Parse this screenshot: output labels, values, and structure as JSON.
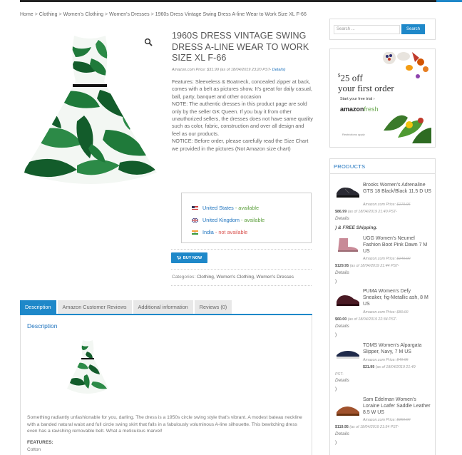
{
  "breadcrumb": [
    "Home",
    "Clothing",
    "Women's Clothing",
    "Women's Dresses",
    "1960s Dress Vintage Swing Dress A-line Wear to Work Size XL F-66"
  ],
  "product": {
    "title_lines": [
      "1960S DRESS VINTAGE SWING",
      "DRESS A-LINE WEAR TO WORK",
      "SIZE XL F-66"
    ],
    "price_prefix": "Amazon.com Price:",
    "price": "$31.99",
    "price_asof": "(as of 18/04/2019 23:20 PST-",
    "price_details": "Details)",
    "description": [
      "Features: Sleeveless & Boatneck, concealed zipper at back, comes with a belt as pictures show. It's great for daily casual, ball, party, banquet and other occasion",
      "NOTE: The authentic dresses in this product page are sold only by the seller GK Queen. If you buy it from other unauthorized sellers, the dresses does not have same quality such as color, fabric, construction and over all design and feel as our products.",
      "NOTICE: Before order, please carefully read the Size Chart we provided in the pictures (Not Amazon size chart)"
    ],
    "availability": [
      {
        "country": "United States",
        "status": "- available",
        "ok": true
      },
      {
        "country": "United Kingdom",
        "status": "- available",
        "ok": true
      },
      {
        "country": "India",
        "status": "- not available",
        "ok": false
      }
    ],
    "buy_label": "BUY NOW",
    "categories_label": "Categories:",
    "categories": "Clothing, Women's Clothing, Women's Dresses"
  },
  "tabs": [
    "Description",
    "Amazon Customer Reviews",
    "Additional information",
    "Reviews (0)"
  ],
  "panel": {
    "title": "Description",
    "text": "Something radiantly unfashionable for you, darling. The dress is a 1950s circle swing style that's vibrant. A modest bateau neckline with a banded natural waist and full circle swing skirt that falls in a fabulously voluminous A-line silhouette. This bewitching dress even has a ravishing removable belt. What a meticulous marvel!",
    "features_label": "FEATURES:",
    "features_value": "Cotton"
  },
  "sidebar": {
    "search_placeholder": "Search ...",
    "search_button": "Search",
    "ad": {
      "amount": "25",
      "currency": "$",
      "off_line1": "off",
      "off_line2": "your first order",
      "trial": "Start your free trial ›",
      "brand_a": "amazon",
      "brand_b": "fresh",
      "restrictions": "Restrictions apply"
    },
    "products_title": "PRODUCTS",
    "products": [
      {
        "name": "Brooks Women's Adrenaline GTS 18 Black/Black 11.5 D US",
        "meta": "Amazon.com Price:",
        "old": "$179.95",
        "price": "$86.99",
        "asof": "(as of 18/04/2019 21:40 PST-",
        "details": "Details",
        "extra": ") & FREE Shipping."
      },
      {
        "name": "UGG Women's Neumel Fashion Boot Pink Dawn 7 M US",
        "meta": "Amazon.com Price:",
        "old": "$140.00",
        "price": "$129.95",
        "asof": "(as of 18/04/2019 21:44 PST-",
        "details": "Details",
        "extra": ")"
      },
      {
        "name": "PUMA Women's Defy Sneaker, fig-Metallic ash, 8 M US",
        "meta": "Amazon.com Price:",
        "old": "$80.00",
        "price": "$60.00",
        "asof": "(as of 18/04/2019 22:34 PST-",
        "details": "Details",
        "extra": ")"
      },
      {
        "name": "TOMS Women's Alpargata Slipper, Navy, 7 M US",
        "meta": "Amazon.com Price:",
        "old": "$49.95",
        "price": "$21.99",
        "asof": "(as of 18/04/2019 21:49",
        "asof2": "PST-",
        "details": "Details",
        "extra": ")"
      },
      {
        "name": "Sam Edelman Women's Loraine Loafer Saddle Leather 8.5 W US",
        "meta": "Amazon.com Price:",
        "old": "$150.00",
        "price": "$119.95",
        "asof": "(as of 18/04/2019 21:54 PST-",
        "details": "Details",
        "extra": ")"
      }
    ]
  },
  "colors": {
    "accent": "#1e88c9",
    "link": "#1e73be",
    "available": "#5a9e3a",
    "unavailable": "#d9534f"
  }
}
